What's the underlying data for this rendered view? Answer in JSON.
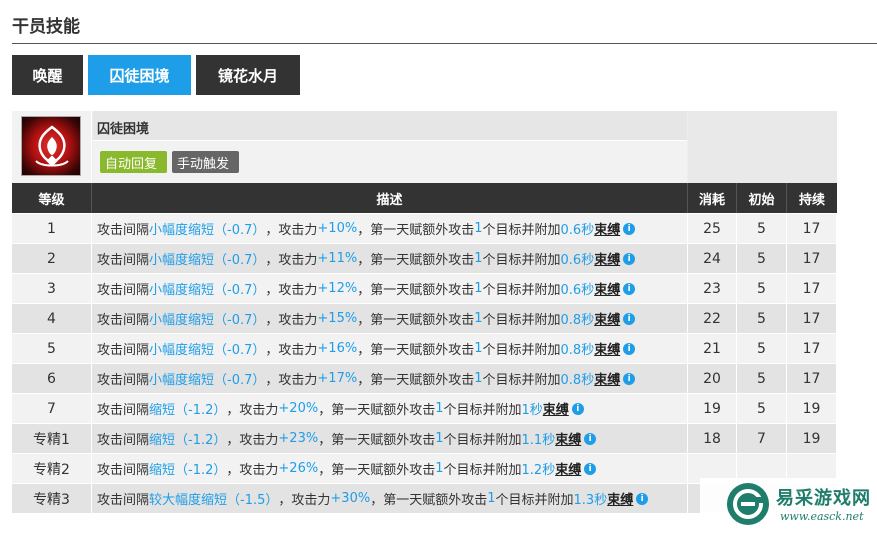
{
  "section_title": "干员技能",
  "tabs": [
    {
      "label": "唤醒",
      "active": false
    },
    {
      "label": "囚徒困境",
      "active": true
    },
    {
      "label": "镜花水月",
      "active": false
    }
  ],
  "skill": {
    "icon": "flame-emblem-icon",
    "name": "囚徒困境",
    "tags": [
      "自动回复",
      "手动触发"
    ]
  },
  "table": {
    "headers": {
      "level": "等级",
      "desc": "描述",
      "cost": "消耗",
      "init": "初始",
      "dur": "持续"
    },
    "rows": [
      {
        "level": "1",
        "interval": "小幅度缩短（-0.7）",
        "atk": "+10%",
        "targets": "1",
        "sec": "0.6秒",
        "effect": "束缚",
        "cost": "25",
        "init": "5",
        "dur": "17"
      },
      {
        "level": "2",
        "interval": "小幅度缩短（-0.7）",
        "atk": "+11%",
        "targets": "1",
        "sec": "0.6秒",
        "effect": "束缚",
        "cost": "24",
        "init": "5",
        "dur": "17"
      },
      {
        "level": "3",
        "interval": "小幅度缩短（-0.7）",
        "atk": "+12%",
        "targets": "1",
        "sec": "0.6秒",
        "effect": "束缚",
        "cost": "23",
        "init": "5",
        "dur": "17"
      },
      {
        "level": "4",
        "interval": "小幅度缩短（-0.7）",
        "atk": "+15%",
        "targets": "1",
        "sec": "0.8秒",
        "effect": "束缚",
        "cost": "22",
        "init": "5",
        "dur": "17"
      },
      {
        "level": "5",
        "interval": "小幅度缩短（-0.7）",
        "atk": "+16%",
        "targets": "1",
        "sec": "0.8秒",
        "effect": "束缚",
        "cost": "21",
        "init": "5",
        "dur": "17"
      },
      {
        "level": "6",
        "interval": "小幅度缩短（-0.7）",
        "atk": "+17%",
        "targets": "1",
        "sec": "0.8秒",
        "effect": "束缚",
        "cost": "20",
        "init": "5",
        "dur": "17"
      },
      {
        "level": "7",
        "interval": "缩短（-1.2）",
        "atk": "+20%",
        "targets": "1",
        "sec": "1秒",
        "effect": "束缚",
        "cost": "19",
        "init": "5",
        "dur": "19"
      },
      {
        "level": "专精1",
        "interval": "缩短（-1.2）",
        "atk": "+23%",
        "targets": "1",
        "sec": "1.1秒",
        "effect": "束缚",
        "cost": "18",
        "init": "7",
        "dur": "19"
      },
      {
        "level": "专精2",
        "interval": "缩短（-1.2）",
        "atk": "+26%",
        "targets": "1",
        "sec": "1.2秒",
        "effect": "束缚",
        "cost": "",
        "init": "",
        "dur": ""
      },
      {
        "level": "专精3",
        "interval": "较大幅度缩短（-1.5）",
        "atk": "+30%",
        "targets": "1",
        "sec": "1.3秒",
        "effect": "束缚",
        "cost": "",
        "init": "",
        "dur": ""
      }
    ],
    "desc_parts": {
      "p1": "攻击间隔",
      "p2": "，攻击力",
      "p3": "，第一天赋额外攻击",
      "p4": "个目标并附加"
    }
  },
  "watermark": {
    "text": "易采游戏网",
    "url": "www.easck.net",
    "color": "#1f7d6b"
  },
  "colors": {
    "accent": "#1e9ee8",
    "dark": "#333333",
    "green_tag": "#8ab92d",
    "gray_tag": "#666666"
  }
}
